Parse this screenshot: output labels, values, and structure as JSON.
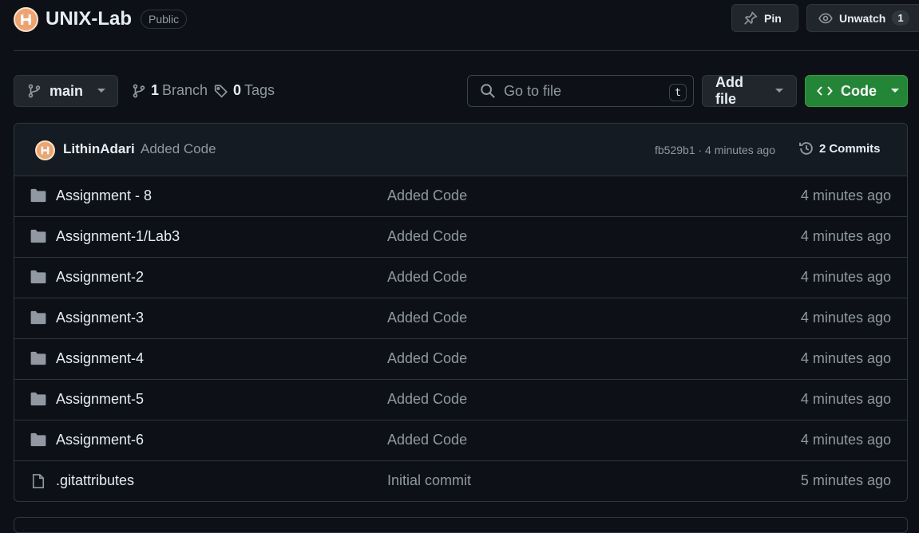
{
  "repo": {
    "name": "UNIX-Lab",
    "visibility": "Public",
    "pin_label": "Pin",
    "watch_label": "Unwatch",
    "watch_count": "1"
  },
  "toolbar": {
    "branch": "main",
    "branch_count": "1",
    "branch_label": "Branch",
    "tag_count": "0",
    "tag_label": "Tags",
    "search_placeholder": "Go to file",
    "search_shortcut": "t",
    "add_file_label": "Add file",
    "code_label": "Code"
  },
  "latest_commit": {
    "author": "LithinAdari",
    "message": "Added Code",
    "meta": "fb529b1 · 4 minutes ago",
    "commits_count": "2",
    "commits_label": "Commits"
  },
  "files": [
    {
      "name": "Assignment - 8",
      "type": "folder",
      "message": "Added Code",
      "date": "4 minutes ago"
    },
    {
      "name": "Assignment-1/Lab3",
      "type": "folder",
      "message": "Added Code",
      "date": "4 minutes ago"
    },
    {
      "name": "Assignment-2",
      "type": "folder",
      "message": "Added Code",
      "date": "4 minutes ago"
    },
    {
      "name": "Assignment-3",
      "type": "folder",
      "message": "Added Code",
      "date": "4 minutes ago"
    },
    {
      "name": "Assignment-4",
      "type": "folder",
      "message": "Added Code",
      "date": "4 minutes ago"
    },
    {
      "name": "Assignment-5",
      "type": "folder",
      "message": "Added Code",
      "date": "4 minutes ago"
    },
    {
      "name": "Assignment-6",
      "type": "folder",
      "message": "Added Code",
      "date": "4 minutes ago"
    },
    {
      "name": ".gitattributes",
      "type": "file",
      "message": "Initial commit",
      "date": "5 minutes ago"
    }
  ],
  "colors": {
    "background": "#0d1117",
    "accent_green": "#238636",
    "folder_icon": "#9198a1"
  },
  "icons": {
    "avatar": "owner-avatar-icon",
    "pin": "pin-icon",
    "watch": "eye-icon",
    "branch": "git-branch-icon",
    "tag": "tag-icon",
    "search": "search-icon",
    "code": "code-icon",
    "history": "history-icon",
    "folder": "folder-icon",
    "file": "file-icon"
  }
}
